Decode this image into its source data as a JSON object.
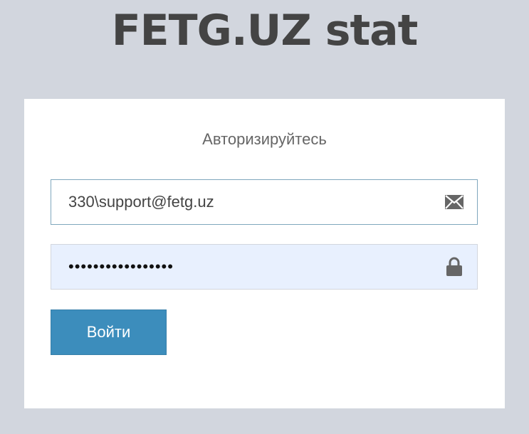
{
  "header": {
    "logo_text": "FETG.UZ stat"
  },
  "login": {
    "message": "Авторизируйтесь",
    "email": {
      "value": "330\\support@fetg.uz",
      "icon": "envelope-icon"
    },
    "password": {
      "value": "•••••••••••••••••",
      "icon": "lock-icon",
      "autofill_color": "#e8f0fe"
    },
    "submit_label": "Войти",
    "accent_color": "#3c8dbc"
  }
}
